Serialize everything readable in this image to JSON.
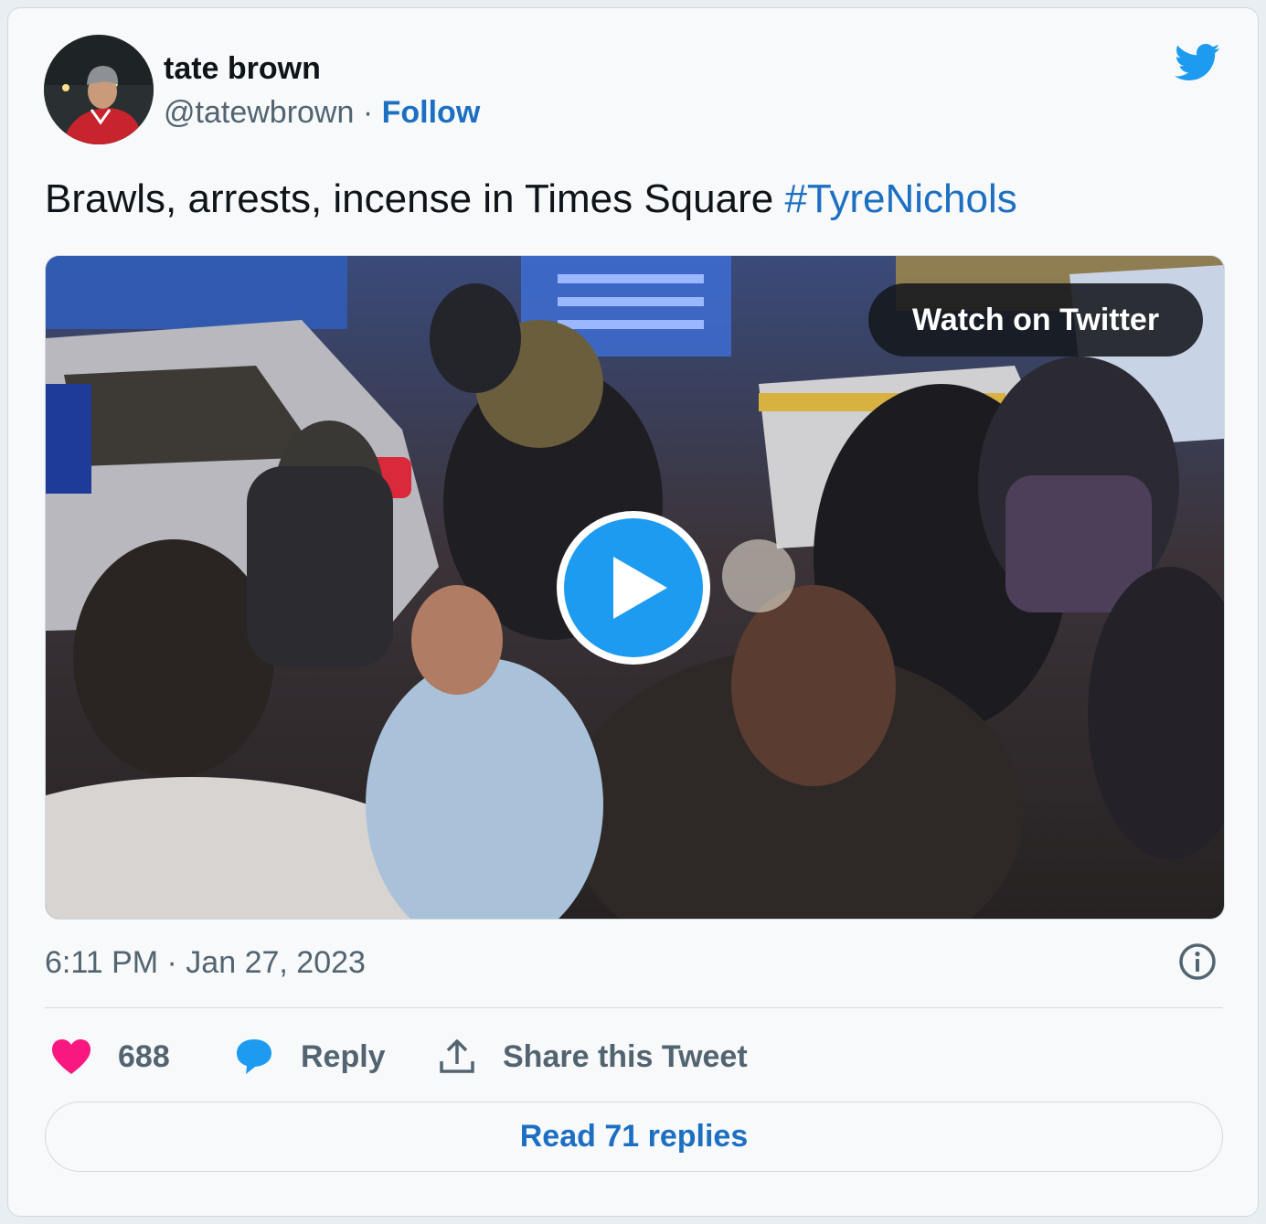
{
  "author": {
    "name": "tate brown",
    "handle": "@tatewbrown",
    "separator": "·",
    "follow_label": "Follow"
  },
  "tweet": {
    "text": "Brawls, arrests, incense in Times Square",
    "hashtag": "#TyreNichols",
    "timestamp": "6:11 PM · Jan 27, 2023"
  },
  "media": {
    "watch_label": "Watch on Twitter"
  },
  "actions": {
    "like_count": "688",
    "reply_label": "Reply",
    "share_label": "Share this Tweet"
  },
  "footer": {
    "read_replies_label": "Read 71 replies"
  },
  "icons": {
    "brand": "twitter-bird-icon",
    "info": "info-icon",
    "like": "heart-icon",
    "reply": "speech-bubble-icon",
    "share": "share-upload-icon",
    "play": "play-icon"
  },
  "colors": {
    "link": "#1d6fc2",
    "twitter_blue": "#1d9bf0",
    "heart": "#f91880",
    "muted_text": "#536471"
  }
}
